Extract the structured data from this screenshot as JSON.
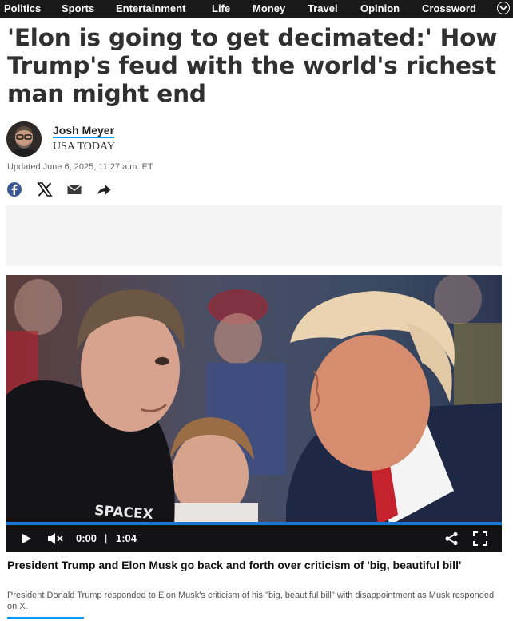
{
  "nav": {
    "items": [
      "Politics",
      "Sports",
      "Entertainment",
      "Life",
      "Money",
      "Travel",
      "Opinion",
      "Crossword"
    ],
    "more_icon": "chevron-down-icon"
  },
  "article": {
    "headline": "'Elon is going to get decimated:' How Trump's feud with the world's richest man might end",
    "author": {
      "name": "Josh Meyer",
      "organization": "USA TODAY"
    },
    "updated": "Updated June 6, 2025, 11:27 a.m. ET"
  },
  "share": {
    "icons": [
      "facebook-icon",
      "x-icon",
      "email-icon",
      "share-icon"
    ]
  },
  "video": {
    "current_time": "0:00",
    "separator": "|",
    "duration": "1:04",
    "shirt_text": "SPACEX",
    "progress": 0
  },
  "caption": {
    "title": "President Trump and Elon Musk go back and forth over criticism of 'big, beautiful bill'",
    "text": "President Donald Trump responded to Elon Musk's criticism of his \"big, beautiful bill\" with disappointment as Musk responded on X."
  },
  "colors": {
    "nav_bg": "#1a1a1a",
    "accent": "#009bff",
    "headline": "#303030",
    "progress": "#1877d9"
  }
}
